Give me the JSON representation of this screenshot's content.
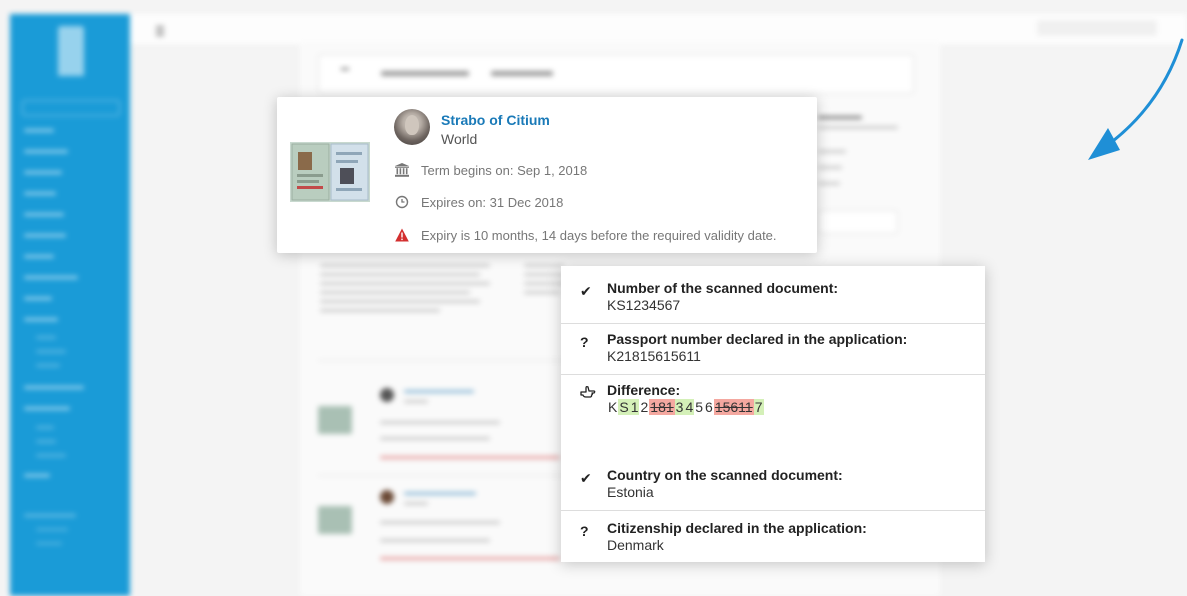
{
  "popup_card": {
    "name": "Strabo of Citium",
    "subtitle": "World",
    "term_begins": "Term begins on: Sep 1, 2018",
    "expires": "Expires on: 31 Dec 2018",
    "warning": "Expiry is 10 months, 14 days before the required validity date.",
    "warning_color": "#d32f2f",
    "name_color": "#1a7ab8"
  },
  "comparison_card": {
    "scanned_number_label": "Number of the scanned document:",
    "scanned_number": "KS1234567",
    "declared_number_label": "Passport number declared in the application:",
    "declared_number": "K21815615611",
    "difference_label": "Difference:",
    "difference": [
      {
        "c": "K",
        "s": "same"
      },
      {
        "c": "S",
        "s": "added"
      },
      {
        "c": "1",
        "s": "added"
      },
      {
        "c": "2",
        "s": "same"
      },
      {
        "c": "181",
        "s": "removed"
      },
      {
        "c": "3",
        "s": "added"
      },
      {
        "c": "4",
        "s": "added"
      },
      {
        "c": "5",
        "s": "same"
      },
      {
        "c": "6",
        "s": "same"
      },
      {
        "c": "15611",
        "s": "removed"
      },
      {
        "c": "7",
        "s": "added"
      }
    ],
    "country_label": "Country on the scanned document:",
    "country": "Estonia",
    "citizenship_label": "Citizenship declared in the application:",
    "citizenship": "Denmark",
    "added_color": "#d4f0b8",
    "removed_color": "#f4a8a0"
  },
  "icons": {
    "match": "check-icon",
    "unknown": "question-icon",
    "difference": "pointing-hand-icon",
    "term": "institution-icon",
    "expiry": "clock-icon",
    "warning": "warning-triangle-icon"
  },
  "accent_color": "#1a9bd7"
}
